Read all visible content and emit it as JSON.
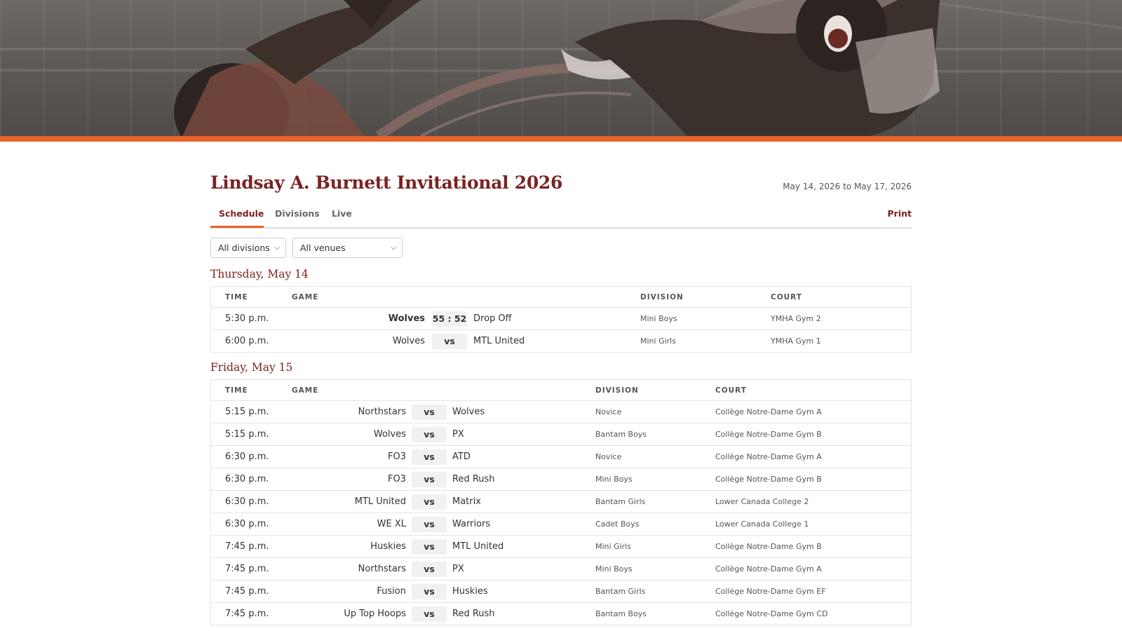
{
  "event": {
    "title": "Lindsay A. Burnett Invitational 2026",
    "date_range": "May 14, 2026 to May 17, 2026"
  },
  "tabs": [
    {
      "label": "Schedule",
      "active": true
    },
    {
      "label": "Divisions",
      "active": false
    },
    {
      "label": "Live",
      "active": false
    }
  ],
  "print_label": "Print",
  "filters": {
    "division": {
      "value": "All divisions"
    },
    "venue": {
      "value": "All venues"
    }
  },
  "columns": {
    "time": "TIME",
    "game": "GAME",
    "division": "DIVISION",
    "court": "COURT"
  },
  "days": [
    {
      "heading": "Thursday, May 14",
      "games": [
        {
          "time": "5:30 p.m.",
          "home": "Wolves",
          "mid": "55 : 52",
          "away": "Drop Off",
          "division": "Mini Boys",
          "court": "YMHA Gym 2",
          "final": true
        },
        {
          "time": "6:00 p.m.",
          "home": "Wolves",
          "mid": "vs",
          "away": "MTL United",
          "division": "Mini Girls",
          "court": "YMHA Gym 1",
          "final": false
        }
      ]
    },
    {
      "heading": "Friday, May 15",
      "games": [
        {
          "time": "5:15 p.m.",
          "home": "Northstars",
          "mid": "vs",
          "away": "Wolves",
          "division": "Novice",
          "court": "Collège Notre-Dame Gym A"
        },
        {
          "time": "5:15 p.m.",
          "home": "Wolves",
          "mid": "vs",
          "away": "PX",
          "division": "Bantam Boys",
          "court": "Collège Notre-Dame Gym B"
        },
        {
          "time": "6:30 p.m.",
          "home": "FO3",
          "mid": "vs",
          "away": "ATD",
          "division": "Novice",
          "court": "Collège Notre-Dame Gym A"
        },
        {
          "time": "6:30 p.m.",
          "home": "FO3",
          "mid": "vs",
          "away": "Red Rush",
          "division": "Mini Boys",
          "court": "Collège Notre-Dame Gym B"
        },
        {
          "time": "6:30 p.m.",
          "home": "MTL United",
          "mid": "vs",
          "away": "Matrix",
          "division": "Bantam Girls",
          "court": "Lower Canada College 2"
        },
        {
          "time": "6:30 p.m.",
          "home": "WE XL",
          "mid": "vs",
          "away": "Warriors",
          "division": "Cadet Boys",
          "court": "Lower Canada College 1"
        },
        {
          "time": "7:45 p.m.",
          "home": "Huskies",
          "mid": "vs",
          "away": "MTL United",
          "division": "Mini Girls",
          "court": "Collège Notre-Dame Gym B"
        },
        {
          "time": "7:45 p.m.",
          "home": "Northstars",
          "mid": "vs",
          "away": "PX",
          "division": "Mini Boys",
          "court": "Collège Notre-Dame Gym A"
        },
        {
          "time": "7:45 p.m.",
          "home": "Fusion",
          "mid": "vs",
          "away": "Huskies",
          "division": "Bantam Girls",
          "court": "Collège Notre-Dame Gym EF"
        },
        {
          "time": "7:45 p.m.",
          "home": "Up Top Hoops",
          "mid": "vs",
          "away": "Red Rush",
          "division": "Bantam Boys",
          "court": "Collège Notre-Dame Gym CD"
        }
      ]
    }
  ],
  "colors": {
    "accent_orange": "#e8642b",
    "title_maroon": "#7b2222"
  }
}
